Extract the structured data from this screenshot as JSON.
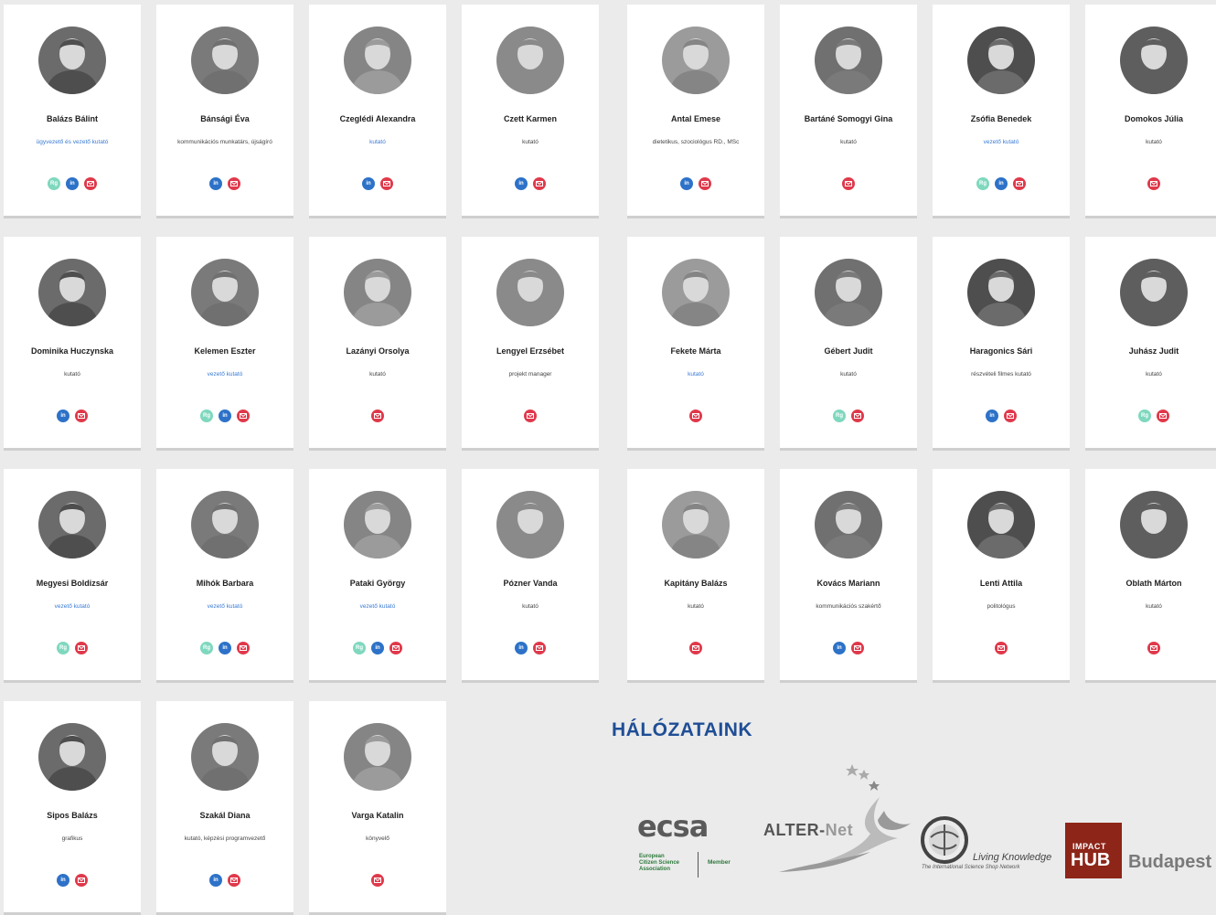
{
  "people": [
    {
      "name": "Balázs Bálint",
      "role": "ügyvezető és vezető kutató",
      "role_link": true,
      "icons": [
        "rg",
        "in",
        "mail"
      ]
    },
    {
      "name": "Bánsági Éva",
      "role": "kommunikációs munkatárs, újságíró",
      "role_link": false,
      "icons": [
        "in",
        "mail"
      ]
    },
    {
      "name": "Czeglédi Alexandra",
      "role": "kutató",
      "role_link": true,
      "icons": [
        "in",
        "mail"
      ]
    },
    {
      "name": "Czett Karmen",
      "role": "kutató",
      "role_link": false,
      "icons": [
        "in",
        "mail"
      ]
    },
    {
      "name": "Antal Emese",
      "role": "dietetikus, szociológus RD., MSc",
      "role_link": false,
      "icons": [
        "in",
        "mail"
      ]
    },
    {
      "name": "Bartáné Somogyi Gina",
      "role": "kutató",
      "role_link": false,
      "icons": [
        "mail"
      ]
    },
    {
      "name": "Zsófia Benedek",
      "role": "vezető kutató",
      "role_link": true,
      "icons": [
        "rg",
        "in",
        "mail"
      ]
    },
    {
      "name": "Domokos Júlia",
      "role": "kutató",
      "role_link": false,
      "icons": [
        "mail"
      ]
    },
    {
      "name": "Dominika Huczynska",
      "role": "kutató",
      "role_link": false,
      "icons": [
        "in",
        "mail"
      ]
    },
    {
      "name": "Kelemen Eszter",
      "role": "vezető kutató",
      "role_link": true,
      "icons": [
        "rg",
        "in",
        "mail"
      ]
    },
    {
      "name": "Lazányi Orsolya",
      "role": "kutató",
      "role_link": false,
      "icons": [
        "mail"
      ]
    },
    {
      "name": "Lengyel Erzsébet",
      "role": "projekt manager",
      "role_link": false,
      "icons": [
        "mail"
      ]
    },
    {
      "name": "Fekete Márta",
      "role": "kutató",
      "role_link": true,
      "icons": [
        "mail"
      ]
    },
    {
      "name": "Gébert Judit",
      "role": "kutató",
      "role_link": false,
      "icons": [
        "rg",
        "mail"
      ]
    },
    {
      "name": "Haragonics Sári",
      "role": "részvételi filmes kutató",
      "role_link": false,
      "icons": [
        "in",
        "mail"
      ]
    },
    {
      "name": "Juhász Judit",
      "role": "kutató",
      "role_link": false,
      "icons": [
        "rg",
        "mail"
      ]
    },
    {
      "name": "Megyesi Boldizsár",
      "role": "vezető kutató",
      "role_link": true,
      "icons": [
        "rg",
        "mail"
      ]
    },
    {
      "name": "Mihók Barbara",
      "role": "vezető kutató",
      "role_link": true,
      "icons": [
        "rg",
        "in",
        "mail"
      ]
    },
    {
      "name": "Pataki György",
      "role": "vezető kutató",
      "role_link": true,
      "icons": [
        "rg",
        "in",
        "mail"
      ]
    },
    {
      "name": "Pózner Vanda",
      "role": "kutató",
      "role_link": false,
      "icons": [
        "in",
        "mail"
      ]
    },
    {
      "name": "Kapitány Balázs",
      "role": "kutató",
      "role_link": false,
      "icons": [
        "mail"
      ]
    },
    {
      "name": "Kovács Mariann",
      "role": "kommunikációs szakértő",
      "role_link": false,
      "icons": [
        "in",
        "mail"
      ]
    },
    {
      "name": "Lenti Attila",
      "role": "politológus",
      "role_link": false,
      "icons": [
        "mail"
      ]
    },
    {
      "name": "Oblath Márton",
      "role": "kutató",
      "role_link": false,
      "icons": [
        "mail"
      ]
    },
    {
      "name": "Sipos Balázs",
      "role": "grafikus",
      "role_link": false,
      "icons": [
        "in",
        "mail"
      ]
    },
    {
      "name": "Szakál Diana",
      "role": "kutató, képzési programvezető",
      "role_link": false,
      "icons": [
        "in",
        "mail"
      ]
    },
    {
      "name": "Varga Katalin",
      "role": "könyvelő",
      "role_link": false,
      "icons": [
        "mail"
      ]
    }
  ],
  "icon_labels": {
    "rg": "Rg",
    "in": "in"
  },
  "colors": {
    "rg": "#7fd8be",
    "in": "#2d72c8",
    "mail": "#e0394b",
    "title": "#1f4e96"
  },
  "networks": {
    "title": "HÁLÓZATAINK",
    "ecsa": {
      "word": "ecsa",
      "line1": "European",
      "line2": "Citizen Science",
      "line3": "Association",
      "member": "Member"
    },
    "alternet": {
      "alter": "ALTER-",
      "net": "Net"
    },
    "living_knowledge": {
      "title": "Living Knowledge",
      "subtitle": "The International Science Shop Network"
    },
    "impact_hub": {
      "impact": "IMPACT",
      "hub": "HUB",
      "city": "Budapest"
    }
  }
}
